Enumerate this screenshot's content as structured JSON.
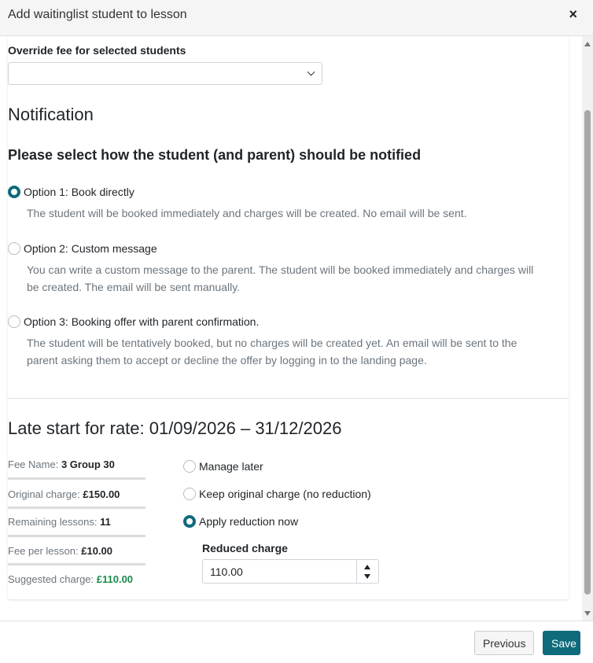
{
  "dialog": {
    "title": "Add waitinglist student to lesson",
    "close_symbol": "×"
  },
  "override": {
    "label": "Override fee for selected students",
    "selected_value": ""
  },
  "notification": {
    "heading": "Notification",
    "question": "Please select how the student (and parent) should be notified",
    "options": [
      {
        "label": "Option 1: Book directly",
        "description": "The student will be booked immediately and charges will be created. No email will be sent.",
        "checked": true
      },
      {
        "label": "Option 2: Custom message",
        "description_line1": "You can write a custom message to the parent. The student will be booked immediately and charges will",
        "description_line2": "be created. The email will be sent manually.",
        "checked": false
      },
      {
        "label": "Option 3: Booking offer with parent confirmation.",
        "description_line1": "The student will be tentatively booked, but no charges will be created yet. An email will be sent to the",
        "description_line2": "parent asking them to accept or decline the offer by logging in to the landing page.",
        "checked": false
      }
    ]
  },
  "late_start": {
    "heading": "Late start for rate: 01/09/2026 – 31/12/2026",
    "fee_name_label": "Fee Name:",
    "fee_name_value": "3 Group 30",
    "original_charge_label": "Original charge:",
    "original_charge_value": "£150.00",
    "remaining_lessons_label": "Remaining lessons:",
    "remaining_lessons_value": "11",
    "fee_per_lesson_label": "Fee per lesson:",
    "fee_per_lesson_value": "£10.00",
    "suggested_charge_label": "Suggested charge:",
    "suggested_charge_value": "£110.00",
    "choices": [
      {
        "label": "Manage later",
        "checked": false
      },
      {
        "label": "Keep original charge (no reduction)",
        "checked": false
      },
      {
        "label": "Apply reduction now",
        "checked": true
      }
    ],
    "reduced_charge_label": "Reduced charge",
    "reduced_charge_value": "110.00"
  },
  "footer": {
    "previous_label": "Previous",
    "save_label": "Save"
  },
  "colors": {
    "accent": "#0f6a7c",
    "suggested_green": "#1a8a4a"
  }
}
